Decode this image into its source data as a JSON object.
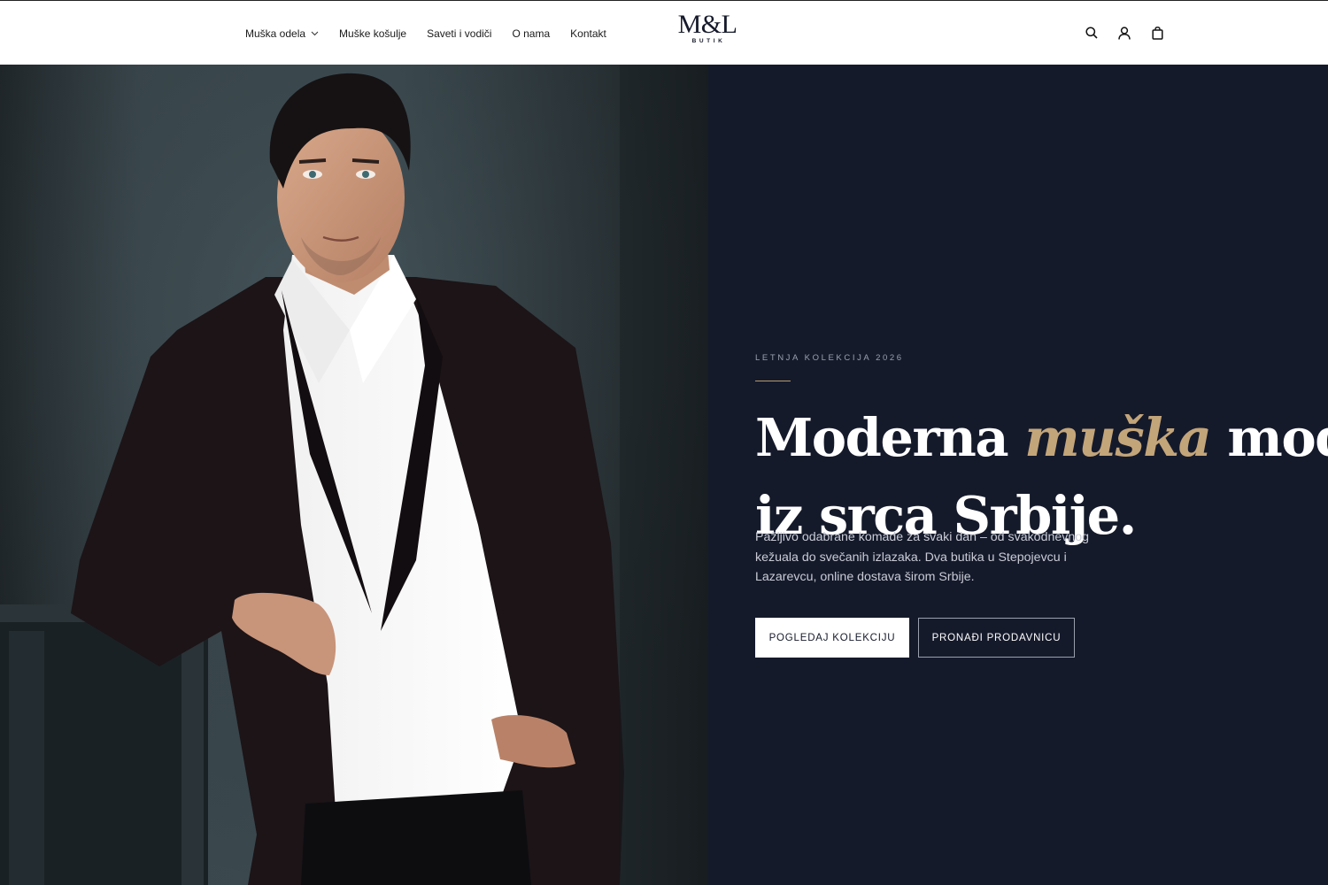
{
  "header": {
    "nav": [
      {
        "label": "Muška odela",
        "has_dropdown": true
      },
      {
        "label": "Muške košulje"
      },
      {
        "label": "Saveti i vodiči"
      },
      {
        "label": "O nama"
      },
      {
        "label": "Kontakt"
      }
    ],
    "logo": {
      "main": "M&L",
      "sub": "BUTIK"
    },
    "icons": [
      "search-icon",
      "user-icon",
      "shopping-bag-icon"
    ]
  },
  "hero": {
    "eyebrow": "LETNJA KOLEKCIJA 2026",
    "headline_part1": "Moderna ",
    "headline_accent": "muška",
    "headline_part2": " moda",
    "headline_line2": "iz srca Srbije.",
    "lead": "Pažljivo odabrane komade za svaki dan – od svakodnevnog kežuala do svečanih izlazaka. Dva butika u Stepojevcu i Lazarevcu, online dostava širom Srbije.",
    "primary_button": "POGLEDAJ KOLEKCIJU",
    "secondary_button": "PRONAĐI PRODAVNICU"
  },
  "colors": {
    "hero_bg": "#151a2b",
    "accent_gold": "#c3a57a",
    "header_bg": "#ffffff",
    "text_dark": "#1b1b1b"
  }
}
